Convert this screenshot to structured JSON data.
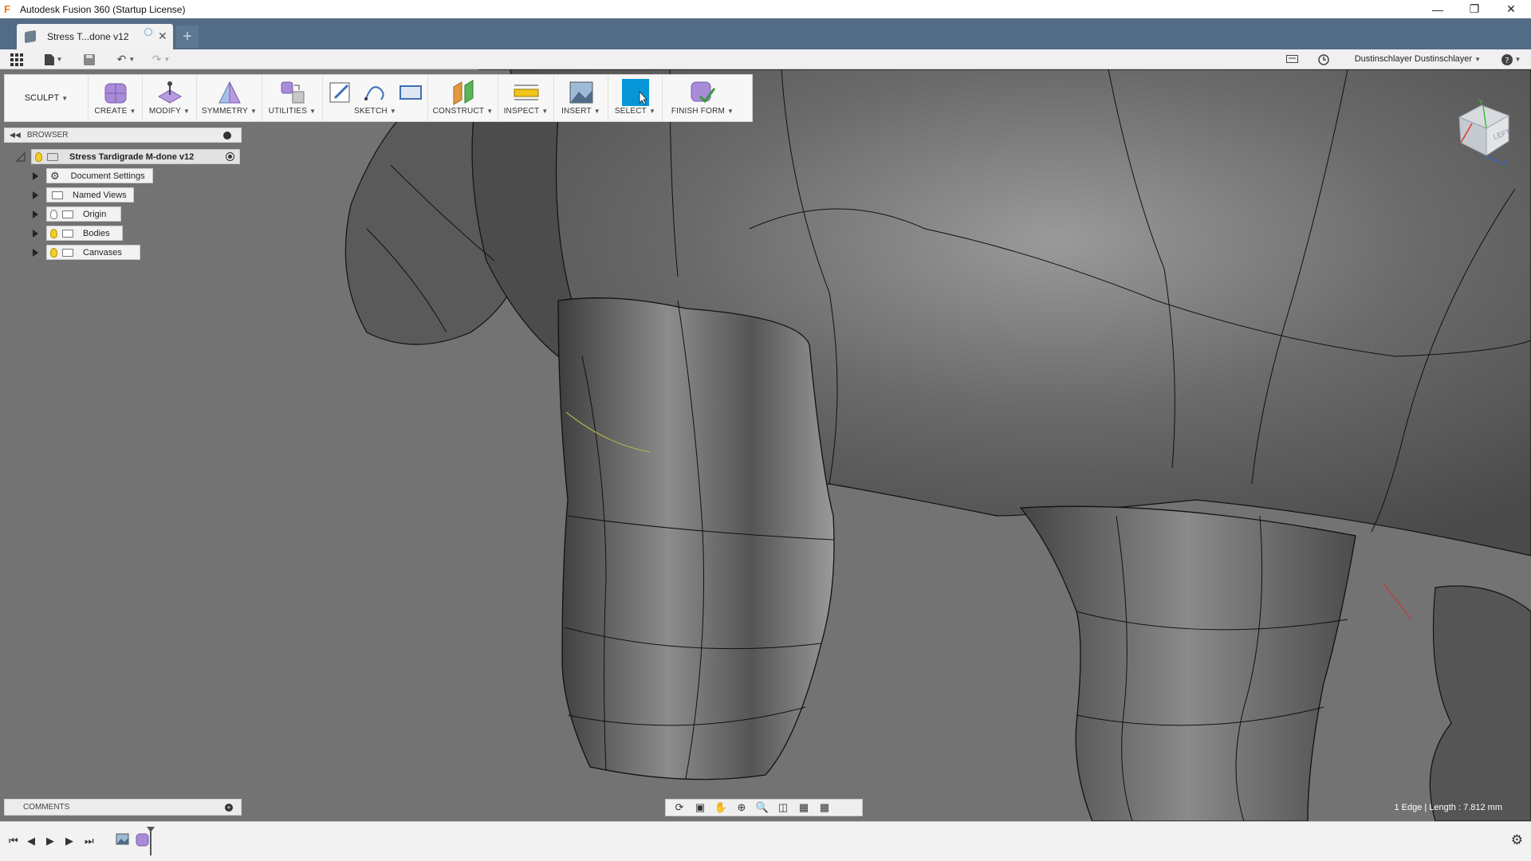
{
  "window": {
    "title": "Autodesk Fusion 360 (Startup License)",
    "logo": "F"
  },
  "tabs": [
    {
      "label": "Stress T...done v12"
    }
  ],
  "user": {
    "name": "Dustinschlayer Dustinschlayer"
  },
  "toolbar": {
    "workspace": "SCULPT",
    "groups": [
      {
        "label": "CREATE"
      },
      {
        "label": "MODIFY"
      },
      {
        "label": "SYMMETRY"
      },
      {
        "label": "UTILITIES"
      },
      {
        "label": "SKETCH"
      },
      {
        "label": "CONSTRUCT"
      },
      {
        "label": "INSPECT"
      },
      {
        "label": "INSERT"
      },
      {
        "label": "SELECT"
      },
      {
        "label": "FINISH FORM"
      }
    ]
  },
  "browser": {
    "title": "BROWSER",
    "root": "Stress Tardigrade M-done v12",
    "items": [
      {
        "label": "Document Settings"
      },
      {
        "label": "Named Views"
      },
      {
        "label": "Origin"
      },
      {
        "label": "Bodies"
      },
      {
        "label": "Canvases"
      }
    ]
  },
  "comments": {
    "title": "COMMENTS"
  },
  "viewcube": {
    "face": "LEFT",
    "axis_y": "Y",
    "axis_z": "Z"
  },
  "status": {
    "text": "1 Edge | Length : 7.812 mm"
  },
  "colors": {
    "accent": "#0696d7",
    "tabbar": "#536c85",
    "viewport": "#737373"
  },
  "icons": {
    "app_grid": "grid-icon",
    "file": "file-icon",
    "save": "save-icon",
    "undo": "undo-icon",
    "redo": "redo-icon",
    "notifications": "message-icon",
    "job_status": "clock-icon",
    "help": "help-icon"
  }
}
